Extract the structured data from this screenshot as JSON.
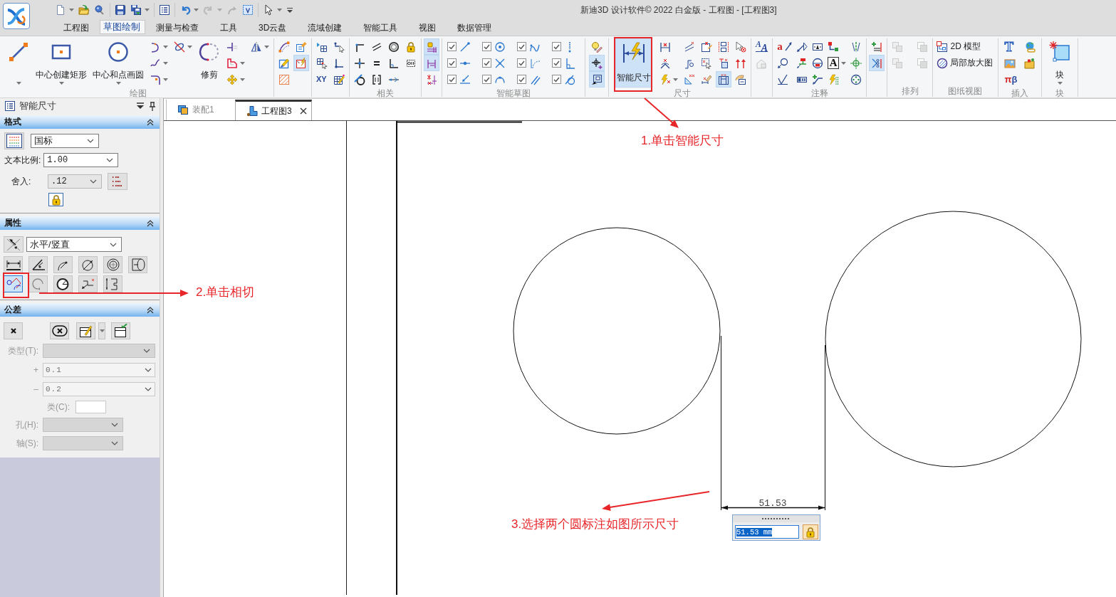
{
  "window": {
    "title": "新迪3D 设计软件© 2022 白金版 - 工程图 - [工程图3]"
  },
  "quick_access": [
    {
      "disabled": false
    },
    {
      "disabled": false
    },
    {
      "disabled": false
    },
    {
      "disabled": false
    },
    {
      "disabled": false
    },
    {
      "disabled": false
    },
    {
      "disabled": false
    },
    {
      "disabled": true
    },
    {
      "disabled": true
    },
    {
      "disabled": false
    },
    {
      "disabled": false
    },
    {
      "disabled": false
    }
  ],
  "menu_tabs": [
    {
      "label": "工程图",
      "selected": false
    },
    {
      "label": "草图绘制",
      "selected": true
    },
    {
      "label": "测量与检查",
      "selected": false
    },
    {
      "label": "工具",
      "selected": false
    },
    {
      "label": "3D云盘",
      "selected": false
    },
    {
      "label": "流域创建",
      "selected": false
    },
    {
      "label": "智能工具",
      "selected": false
    },
    {
      "label": "视图",
      "selected": false
    },
    {
      "label": "数据管理",
      "selected": false
    }
  ],
  "ribbon": [
    {
      "label": "绘图",
      "columns": [
        [
          {
            "kind": "large",
            "pressed": false
          }
        ],
        [
          {
            "kind": "large",
            "label": "中心创建矩形",
            "pressed": false
          }
        ],
        [
          {
            "kind": "large",
            "label": "中心和点画圆",
            "pressed": false
          }
        ],
        [
          {
            "kind": "small",
            "pressed": false
          },
          {
            "kind": "small",
            "pressed": false
          },
          {
            "kind": "small",
            "pressed": false
          }
        ],
        [
          {
            "kind": "small",
            "pressed": false
          }
        ],
        [
          {
            "kind": "large",
            "label": "修剪",
            "pressed": false
          }
        ],
        [
          {
            "kind": "small",
            "pressed": false
          },
          {
            "kind": "small",
            "pressed": false
          },
          {
            "kind": "small",
            "pressed": false
          }
        ],
        [
          {
            "kind": "small",
            "pressed": false
          }
        ]
      ]
    },
    {
      "columns": [
        [
          {
            "kind": "small",
            "pressed": false
          },
          {
            "kind": "small",
            "pressed": false
          },
          {
            "kind": "small",
            "pressed": false
          }
        ],
        [
          {
            "kind": "small",
            "pressed": false
          },
          {
            "kind": "small",
            "pressed": true
          }
        ]
      ]
    },
    {
      "columns": [
        [
          {
            "kind": "small",
            "pressed": false
          },
          {
            "kind": "small",
            "pressed": false
          },
          {
            "kind": "glyph",
            "text": "XY",
            "pressed": false
          }
        ],
        [
          {
            "kind": "small",
            "pressed": false
          },
          {
            "kind": "small",
            "pressed": false
          },
          {
            "kind": "small",
            "pressed": false
          }
        ]
      ]
    },
    {
      "label": "相关",
      "columns": [
        [
          {
            "kind": "small",
            "pressed": false
          },
          {
            "kind": "small",
            "pressed": false
          },
          {
            "kind": "small",
            "pressed": false
          }
        ],
        [
          {
            "kind": "small",
            "pressed": false
          },
          {
            "kind": "small",
            "pressed": false
          },
          {
            "kind": "small",
            "pressed": false
          }
        ],
        [
          {
            "kind": "small",
            "pressed": false
          },
          {
            "kind": "small",
            "pressed": false
          },
          {
            "kind": "small",
            "pressed": false
          }
        ],
        [
          {
            "kind": "small",
            "pressed": false
          },
          {
            "kind": "small",
            "pressed": false
          }
        ]
      ]
    },
    {
      "columns": [
        [
          {
            "kind": "small",
            "pressed": true
          },
          {
            "kind": "small",
            "pressed": true
          },
          {
            "kind": "small",
            "pressed": false
          }
        ]
      ]
    },
    {
      "label": "智能草图",
      "columns": [
        [
          {
            "kind": "check",
            "checked": true
          },
          {
            "kind": "check",
            "checked": true
          },
          {
            "kind": "check",
            "checked": true
          }
        ],
        [
          {
            "kind": "check",
            "checked": true
          },
          {
            "kind": "check",
            "checked": true
          },
          {
            "kind": "check",
            "checked": true
          }
        ],
        [
          {
            "kind": "check",
            "checked": true
          },
          {
            "kind": "check",
            "checked": true
          },
          {
            "kind": "check",
            "checked": true
          }
        ],
        [
          {
            "kind": "check",
            "checked": true
          },
          {
            "kind": "check",
            "checked": true
          },
          {
            "kind": "check",
            "checked": true
          }
        ]
      ]
    },
    {
      "columns": [
        [
          {
            "kind": "small",
            "pressed": false
          },
          {
            "kind": "small",
            "pressed": true
          },
          {
            "kind": "small",
            "pressed": true
          }
        ]
      ]
    },
    {
      "label": "尺寸",
      "columns": [
        [
          {
            "kind": "large",
            "label": "智能尺寸",
            "pressed": true
          }
        ],
        [
          {
            "kind": "small",
            "pressed": false
          },
          {
            "kind": "small",
            "pressed": false
          },
          {
            "kind": "small",
            "pressed": false
          }
        ],
        [
          {
            "kind": "small",
            "pressed": false
          },
          {
            "kind": "small",
            "pressed": false
          },
          {
            "kind": "small",
            "pressed": false
          }
        ],
        [
          {
            "kind": "small",
            "pressed": false
          },
          {
            "kind": "small",
            "pressed": false
          },
          {
            "kind": "small",
            "pressed": false
          }
        ],
        [
          {
            "kind": "small",
            "pressed": false
          },
          {
            "kind": "small",
            "pressed": false
          },
          {
            "kind": "small",
            "pressed": true
          }
        ],
        [
          {
            "kind": "small",
            "pressed": false
          },
          {
            "kind": "small",
            "pressed": false
          },
          {
            "kind": "small",
            "pressed": false
          }
        ]
      ]
    },
    {
      "columns": [
        [
          {
            "kind": "glyph",
            "text": "$^{A}$A",
            "pressed": false,
            "disabled": false
          },
          {
            "kind": "small",
            "pressed": false,
            "disabled": true
          }
        ]
      ]
    },
    {
      "label": "注释",
      "columns": [
        [
          {
            "kind": "glyph",
            "text": "a",
            "pressed": false
          },
          {
            "kind": "small",
            "pressed": false
          },
          {
            "kind": "small",
            "pressed": false
          }
        ],
        [
          {
            "kind": "small",
            "pressed": false
          },
          {
            "kind": "small",
            "pressed": false
          },
          {
            "kind": "small",
            "pressed": false
          }
        ],
        [
          {
            "kind": "small",
            "pressed": false
          },
          {
            "kind": "small",
            "pressed": false
          },
          {
            "kind": "small",
            "pressed": false
          }
        ],
        [
          {
            "kind": "small",
            "pressed": false
          },
          {
            "kind": "glyph",
            "text": "A",
            "pressed": false
          },
          {
            "kind": "small",
            "pressed": false
          }
        ],
        [
          {
            "kind": "small",
            "pressed": false
          },
          {
            "kind": "small",
            "pressed": false
          },
          {
            "kind": "small",
            "pressed": false
          }
        ]
      ]
    },
    {
      "columns": [
        [
          {
            "kind": "small",
            "pressed": false
          },
          {
            "kind": "small",
            "pressed": true
          }
        ]
      ]
    },
    {
      "label": "排列",
      "columns": [
        [
          {
            "kind": "small",
            "pressed": false,
            "disabled": true
          },
          {
            "kind": "small",
            "pressed": false,
            "disabled": true
          }
        ],
        [
          {
            "kind": "small",
            "pressed": false,
            "disabled": true
          },
          {
            "kind": "small",
            "pressed": false,
            "disabled": true
          }
        ]
      ]
    },
    {
      "label": "图纸视图",
      "columns": [
        [
          {
            "kind": "small",
            "label": "2D 模型",
            "pressed": false
          },
          {
            "kind": "small",
            "label": "局部放大图",
            "pressed": false
          }
        ]
      ]
    },
    {
      "label": "插入",
      "columns": [
        [
          {
            "kind": "glyph",
            "text": "T",
            "pressed": false
          },
          {
            "kind": "small",
            "pressed": false
          },
          {
            "kind": "glyph",
            "text": "πβ",
            "pressed": false
          }
        ],
        [
          {
            "kind": "small",
            "pressed": false
          },
          {
            "kind": "small",
            "pressed": false
          }
        ]
      ]
    },
    {
      "label": "块",
      "columns": [
        [
          {
            "kind": "large",
            "label": "块",
            "pressed": false
          }
        ]
      ]
    }
  ],
  "property_panel": {
    "title": "智能尺寸",
    "sections": [
      {
        "kind": "format",
        "title": "格式",
        "expanded": true,
        "standard": "国标",
        "text_scale": {
          "label": "文本比例:",
          "value": "1.00"
        },
        "rounding": {
          "label": "舍入:",
          "value": ".12"
        }
      },
      {
        "kind": "properties",
        "title": "属性",
        "expanded": true,
        "direction": "水平/竖直",
        "dimension_types": [
          {
            "selected": false
          },
          {
            "selected": false
          },
          {
            "selected": false
          },
          {
            "selected": false
          },
          {
            "selected": false
          },
          {
            "selected": false
          },
          {
            "selected": true
          },
          {
            "selected": false
          },
          {
            "selected": false
          },
          {
            "selected": false
          },
          {
            "selected": false
          }
        ]
      },
      {
        "kind": "tolerance",
        "title": "公差",
        "expanded": true,
        "fields": [
          {
            "kind": "select",
            "label": "类型(T):",
            "disabled": true
          },
          {
            "kind": "text",
            "label": "+",
            "value": "0.1",
            "disabled": true
          },
          {
            "kind": "text",
            "label": "–",
            "value": "0.2",
            "disabled": true
          },
          {
            "kind": "small_text",
            "label": "类(C):",
            "disabled": true
          },
          {
            "kind": "select",
            "label": "孔(H):",
            "disabled": true
          },
          {
            "kind": "select",
            "label": "轴(S):",
            "disabled": true
          }
        ]
      }
    ]
  },
  "document_tabs": [
    {
      "label": "装配1",
      "selected": false
    },
    {
      "label": "工程图3",
      "selected": true
    }
  ],
  "drawing": {
    "dimension_text": "51.53",
    "input_value": "51.53 mm"
  },
  "annotations": [
    {
      "text": "1.单击智能尺寸"
    },
    {
      "text": "2.单击相切"
    },
    {
      "text": "3.选择两个圆标注如图所示尺寸"
    }
  ]
}
